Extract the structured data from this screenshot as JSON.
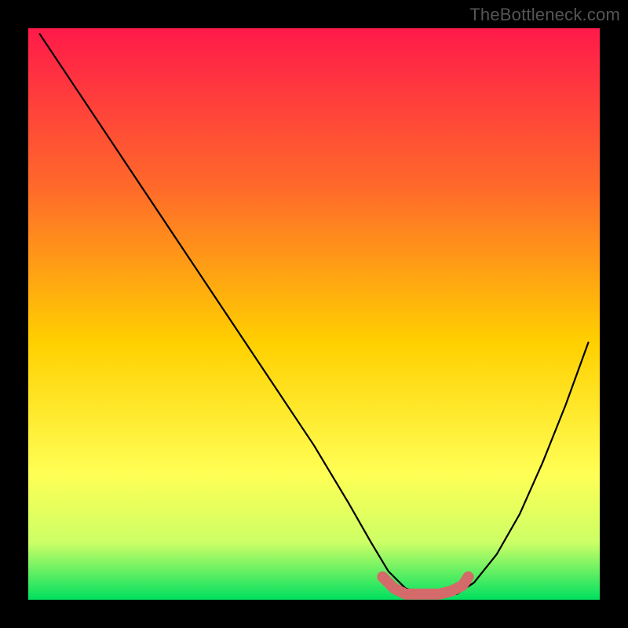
{
  "watermark": "TheBottleneck.com",
  "chart_data": {
    "type": "line",
    "title": "",
    "xlabel": "",
    "ylabel": "",
    "xlim": [
      0,
      100
    ],
    "ylim": [
      0,
      100
    ],
    "grid": false,
    "legend": false,
    "gradient_colors": {
      "top": "#ff1a4a",
      "mid1": "#ff6a2a",
      "mid2": "#ffd000",
      "mid3": "#ffff55",
      "mid4": "#ccff66",
      "bottom": "#00e060"
    },
    "series": [
      {
        "name": "curve",
        "color": "#000000",
        "x": [
          2,
          8,
          14,
          20,
          26,
          32,
          38,
          44,
          50,
          56,
          60,
          63,
          66,
          69,
          72,
          75,
          78,
          82,
          86,
          90,
          94,
          98
        ],
        "y": [
          99,
          90,
          81,
          72,
          63,
          54,
          45,
          36,
          27,
          17,
          10,
          5,
          2,
          1,
          1,
          1,
          3,
          8,
          15,
          24,
          34,
          45
        ]
      },
      {
        "name": "trough-highlight",
        "color": "#d46a6a",
        "x": [
          62,
          64,
          66,
          68,
          70,
          72,
          74,
          76,
          77
        ],
        "y": [
          4,
          2,
          1,
          1,
          1,
          1,
          1.5,
          2.5,
          4
        ]
      }
    ],
    "highlight_endpoint": {
      "x": 77,
      "y": 4,
      "color": "#d46a6a",
      "r": 6
    }
  }
}
